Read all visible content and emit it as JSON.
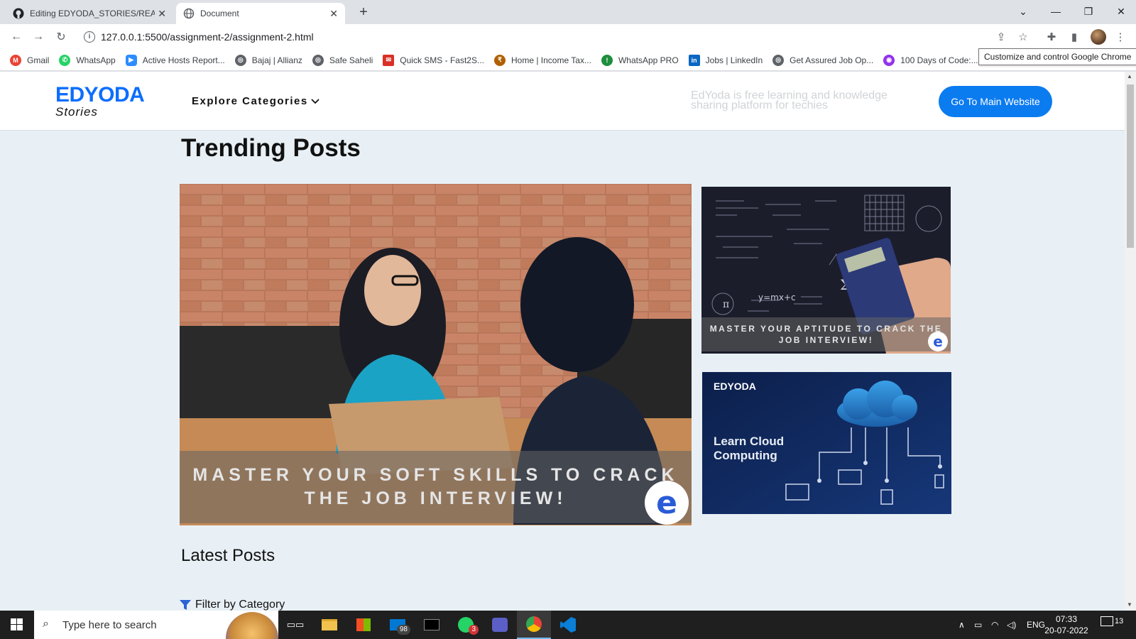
{
  "browser": {
    "tabs": [
      {
        "title": "Editing EDYODA_STORIES/READM",
        "active": false
      },
      {
        "title": "Document",
        "active": true
      }
    ],
    "new_tab_symbol": "+",
    "url": "127.0.0.1:5500/assignment-2/assignment-2.html",
    "tooltip": "Customize and control Google Chrome",
    "bookmarks": [
      {
        "label": "Gmail",
        "icon": "gmail-icon",
        "color": "#ea4335"
      },
      {
        "label": "WhatsApp",
        "icon": "whatsapp-icon",
        "color": "#25d366"
      },
      {
        "label": "Active Hosts Report...",
        "icon": "zoom-icon",
        "color": "#2d8cff"
      },
      {
        "label": "Bajaj | Allianz",
        "icon": "globe-icon",
        "color": "#5f6368"
      },
      {
        "label": "Safe Saheli",
        "icon": "globe-icon",
        "color": "#5f6368"
      },
      {
        "label": "Quick SMS - Fast2S...",
        "icon": "sms-icon",
        "color": "#d93025"
      },
      {
        "label": "Home | Income Tax...",
        "icon": "income-tax-icon",
        "color": "#b06000"
      },
      {
        "label": "WhatsApp PRO",
        "icon": "whatsapp-pro-icon",
        "color": "#1e8e3e"
      },
      {
        "label": "Jobs | LinkedIn",
        "icon": "linkedin-icon",
        "color": "#0a66c2"
      },
      {
        "label": "Get Assured Job Op...",
        "icon": "globe-icon",
        "color": "#5f6368"
      },
      {
        "label": "100 Days of Code:...",
        "icon": "code-icon",
        "color": "#9333ea"
      }
    ]
  },
  "page": {
    "logo_brand": "EDYODA",
    "logo_sub": "Stories",
    "nav_explore": "Explore Categories",
    "tagline": "EdYoda is free learning and knowledge sharing platform for techies",
    "main_button": "Go To Main Website",
    "trending_heading": "Trending Posts",
    "posts": {
      "big_banner": "MASTER YOUR SOFT SKILLS TO CRACK THE JOB INTERVIEW!",
      "small1_banner": "MASTER YOUR APTITUDE TO CRACK THE JOB INTERVIEW!",
      "small2_brand": "EDYODA",
      "small2_title": "Learn Cloud Computing",
      "badge_letter": "e"
    },
    "latest_heading": "Latest Posts",
    "filter_label": "Filter by Category",
    "accent_color": "#0b7bf0"
  },
  "taskbar": {
    "search_placeholder": "Type here to search",
    "mail_badge": "98",
    "whatsapp_badge": "3",
    "language": "ENG",
    "time": "07:33",
    "date": "20-07-2022",
    "notification_count": "13"
  }
}
